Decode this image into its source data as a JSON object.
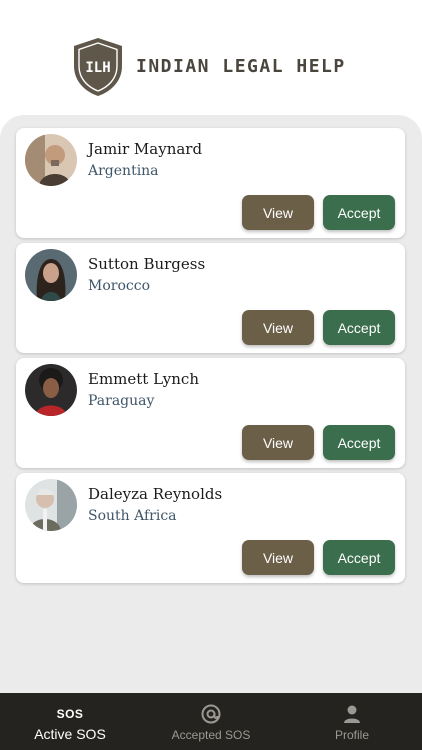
{
  "app": {
    "brand": "INDIAN LEGAL HELP",
    "logo_letters": "ILH"
  },
  "requests": [
    {
      "name": "Jamir Maynard",
      "country": "Argentina",
      "view_label": "View",
      "accept_label": "Accept"
    },
    {
      "name": "Sutton Burgess",
      "country": "Morocco",
      "view_label": "View",
      "accept_label": "Accept"
    },
    {
      "name": "Emmett Lynch",
      "country": "Paraguay",
      "view_label": "View",
      "accept_label": "Accept"
    },
    {
      "name": "Daleyza Reynolds",
      "country": "South Africa",
      "view_label": "View",
      "accept_label": "Accept"
    }
  ],
  "tabs": [
    {
      "label": "Active SOS",
      "icon": "sos-icon",
      "icon_text": "SOS",
      "active": true
    },
    {
      "label": "Accepted SOS",
      "icon": "at-sign-icon",
      "active": false
    },
    {
      "label": "Profile",
      "icon": "person-icon",
      "active": false
    }
  ],
  "colors": {
    "view_button": "#6c5f48",
    "accept_button": "#3a6e4c",
    "tab_bar": "#25231f",
    "panel": "#ebebeb"
  }
}
